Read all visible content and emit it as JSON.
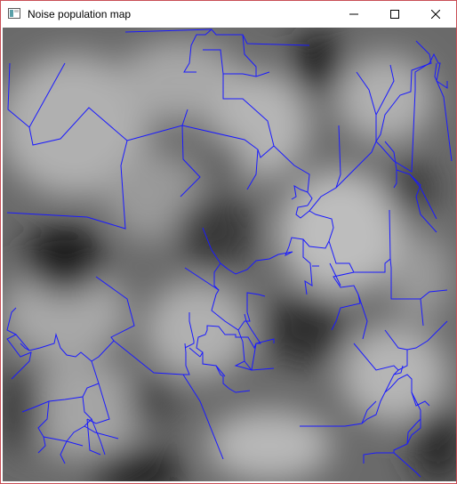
{
  "window": {
    "title": "Noise population map",
    "controls": {
      "minimize": "minimize",
      "maximize": "maximize",
      "close": "close"
    }
  },
  "map": {
    "description": "grayscale noise heightmap with blue branching network",
    "road_color": "#1a1aff",
    "noise_colors": {
      "dark": "#1e1e1e",
      "mid": "#6a6a6a",
      "light": "#b5b5b5"
    }
  }
}
